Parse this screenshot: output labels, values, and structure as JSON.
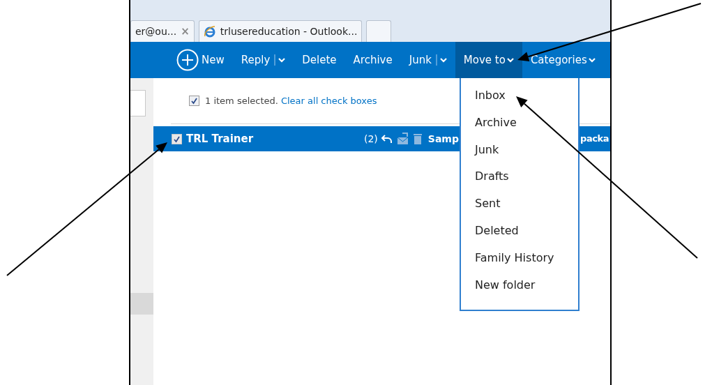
{
  "browser_tabs": [
    {
      "label": "er@ou...",
      "close": "×",
      "kind": "page"
    },
    {
      "label": "trlusereducation - Outlook...",
      "kind": "ie"
    },
    {
      "kind": "blank"
    }
  ],
  "toolbar": [
    {
      "label": "New",
      "kind": "new",
      "selected": false
    },
    {
      "label": "Reply",
      "kind": "split",
      "selected": false
    },
    {
      "label": "Delete",
      "kind": "plain",
      "selected": false
    },
    {
      "label": "Archive",
      "kind": "plain",
      "selected": false
    },
    {
      "label": "Junk",
      "kind": "split",
      "selected": false
    },
    {
      "label": "Move to",
      "kind": "dropdown",
      "selected": true
    },
    {
      "label": "Categories",
      "kind": "dropdown",
      "selected": false
    }
  ],
  "selection_bar": {
    "checked": true,
    "text": "1 item selected.",
    "link": "Clear all check boxes"
  },
  "messages": [
    {
      "sender": "TRL Trainer",
      "checked": true,
      "selected": true,
      "count": "(2)",
      "subject": "Samp",
      "preview": "packa"
    }
  ],
  "move_menu": [
    "Inbox",
    "Archive",
    "Junk",
    "Drafts",
    "Sent",
    "Deleted",
    "Family History",
    "New folder"
  ]
}
